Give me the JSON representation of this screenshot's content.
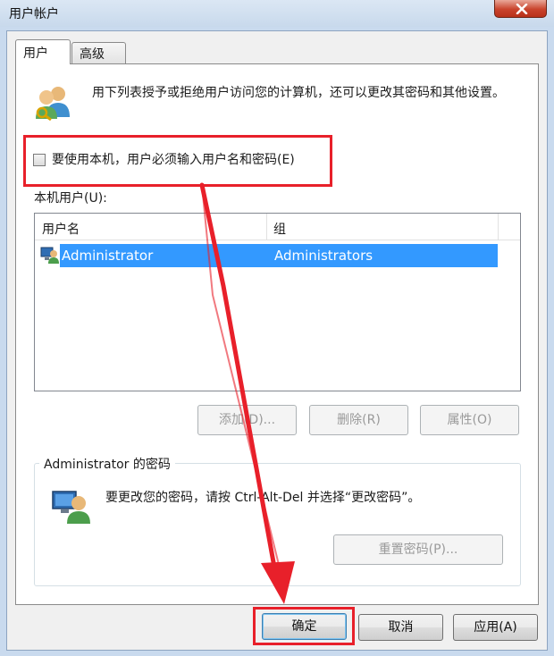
{
  "window": {
    "title": "用户帐户"
  },
  "tabs": [
    {
      "label": "用户"
    },
    {
      "label": "高级"
    }
  ],
  "intro": {
    "text": "用下列表授予或拒绝用户访问您的计算机，还可以更改其密码和其他设置。"
  },
  "require_login": {
    "label": "要使用本机，用户必须输入用户名和密码(E)",
    "checked": false
  },
  "local_users": {
    "label": "本机用户(U):",
    "columns": [
      "用户名",
      "组"
    ],
    "rows": [
      {
        "user": "Administrator",
        "group": "Administrators",
        "selected": true
      }
    ]
  },
  "user_buttons": {
    "add": "添加(D)...",
    "remove": "删除(R)",
    "properties": "属性(O)"
  },
  "password_group": {
    "title": "Administrator 的密码",
    "text": "要更改您的密码，请按 Ctrl-Alt-Del 并选择“更改密码”。",
    "reset_button": "重置密码(P)..."
  },
  "dialog_buttons": {
    "ok": "确定",
    "cancel": "取消",
    "apply": "应用(A)"
  },
  "colors": {
    "highlight": "#e8202a",
    "selection": "#3399ff"
  }
}
